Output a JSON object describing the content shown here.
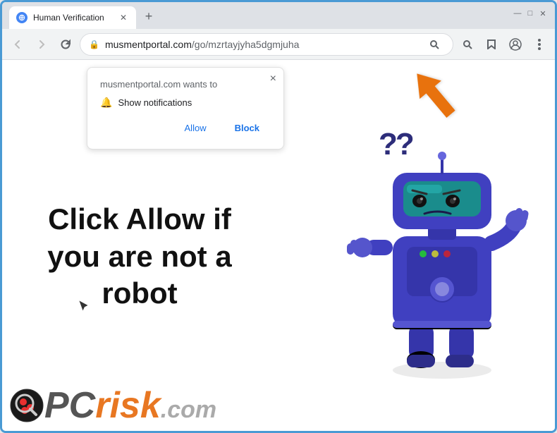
{
  "browser": {
    "tab": {
      "title": "Human Verification",
      "favicon": "globe"
    },
    "new_tab_label": "+",
    "window_controls": {
      "minimize": "—",
      "maximize": "□",
      "close": "✕"
    },
    "nav": {
      "back": "←",
      "forward": "→",
      "reload": "↻"
    },
    "url": {
      "origin": "musmentportal.com",
      "path": "/go/mzrtayjyha5dgmjuha"
    },
    "toolbar_icons": {
      "search": "🔍",
      "bookmark": "☆",
      "profile": "👤",
      "menu": "⋮"
    }
  },
  "notification_popup": {
    "site": "musmentportal.com wants to",
    "notification_label": "Show notifications",
    "allow_button": "Allow",
    "block_button": "Block",
    "close": "×"
  },
  "page": {
    "main_text": "Click Allow if you are not a robot",
    "question_marks": "??"
  },
  "footer": {
    "logo_pc": "PC",
    "logo_risk": "risk",
    "logo_com": ".com"
  }
}
